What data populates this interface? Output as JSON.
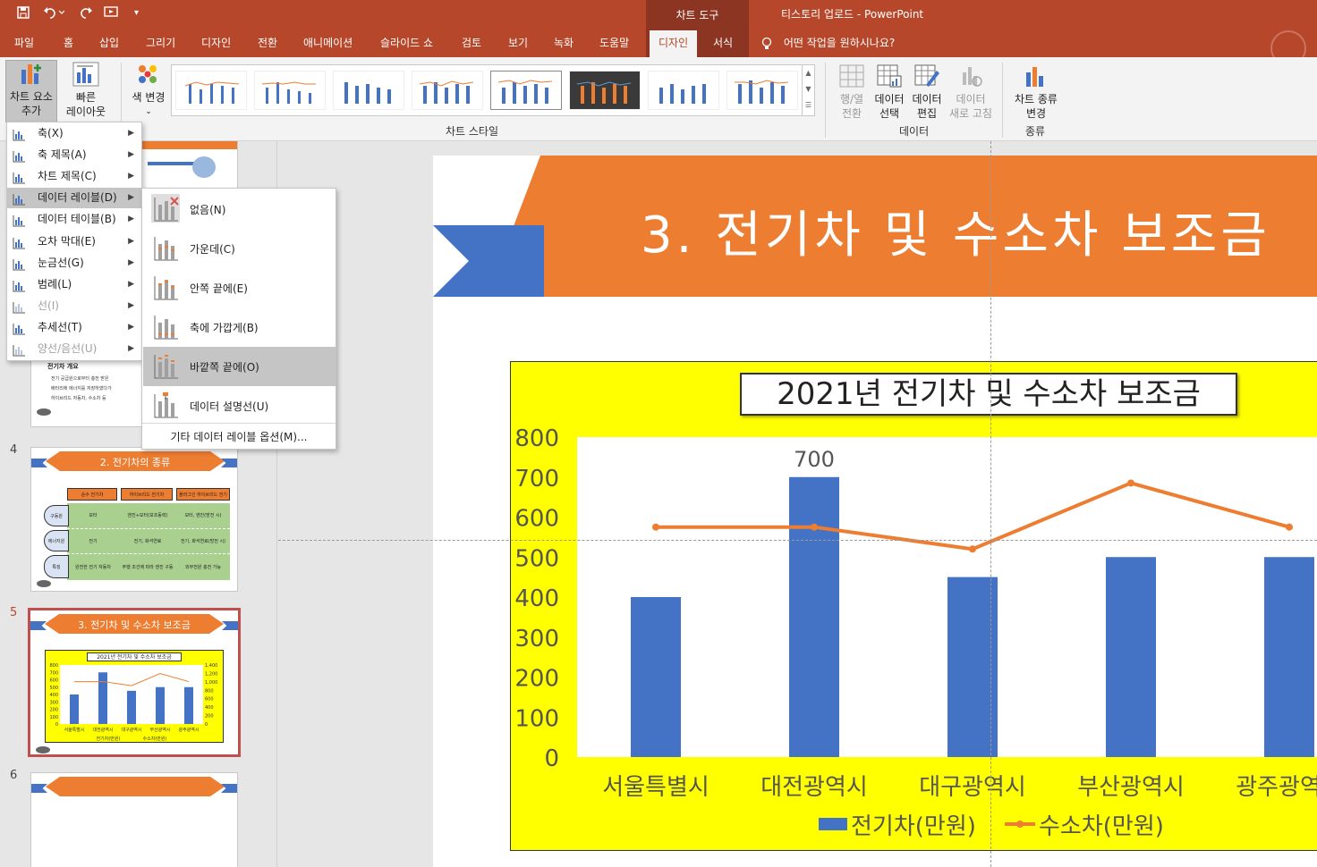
{
  "titlebar": {
    "context_tools": "차트 도구",
    "document_title": "티스토리 업로드  -  PowerPoint"
  },
  "tabs": [
    "파일",
    "홈",
    "삽입",
    "그리기",
    "디자인",
    "전환",
    "애니메이션",
    "슬라이드 쇼",
    "검토",
    "보기",
    "녹화",
    "도움말",
    "디자인",
    "서식"
  ],
  "tell_me": "어떤 작업을 원하시나요?",
  "ribbon": {
    "add_element": [
      "차트 요소",
      "추가"
    ],
    "quick_layout": [
      "빠른",
      "레이아웃"
    ],
    "change_color": "색 변경",
    "chart_styles_label": "차트 스타일",
    "switch_row_col": [
      "행/열",
      "전환"
    ],
    "select_data": [
      "데이터",
      "선택"
    ],
    "edit_data": [
      "데이터",
      "편집"
    ],
    "refresh_data": [
      "데이터",
      "새로 고침"
    ],
    "data_group": "데이터",
    "change_type": [
      "차트 종류",
      "변경"
    ],
    "type_group": "종류"
  },
  "menu_chart_element": [
    {
      "label": "축(X)",
      "enabled": true
    },
    {
      "label": "축 제목(A)",
      "enabled": true
    },
    {
      "label": "차트 제목(C)",
      "enabled": true
    },
    {
      "label": "데이터 레이블(D)",
      "enabled": true
    },
    {
      "label": "데이터 테이블(B)",
      "enabled": true
    },
    {
      "label": "오차 막대(E)",
      "enabled": true
    },
    {
      "label": "눈금선(G)",
      "enabled": true
    },
    {
      "label": "범례(L)",
      "enabled": true
    },
    {
      "label": "선(I)",
      "enabled": false
    },
    {
      "label": "추세선(T)",
      "enabled": true
    },
    {
      "label": "양선/음선(U)",
      "enabled": false
    }
  ],
  "menu_data_labels": [
    "없음(N)",
    "가운데(C)",
    "안쪽 끝에(E)",
    "축에 가깝게(B)",
    "바깥쪽 끝에(O)",
    "데이터 설명선(U)"
  ],
  "menu_more": "기타 데이터 레이블 옵션(M)...",
  "slides": {
    "numbers": [
      "4",
      "5",
      "6"
    ],
    "thumb3_title": "전기차 개요",
    "thumb3_lines": [
      "전기 공급원으로부터 충전 받은",
      "배터리에 에너지를 저장하였다가",
      "하이브리드 자동차, 수소차 등"
    ],
    "thumb4_title": "2. 전기차의 종류",
    "thumb4_table": {
      "headers": [
        "순수 전기차",
        "하이브리드 전기차",
        "플러그인 하이브리드 전기차"
      ],
      "rows": [
        {
          "label": "구동원",
          "cells": [
            "모터",
            "엔진+모터(보조동력)",
            "모터, 엔진(방전 시)"
          ]
        },
        {
          "label": "에너지원",
          "cells": [
            "전기",
            "전기, 화석연료",
            "전기, 화석연료(방전 시)"
          ]
        },
        {
          "label": "특징",
          "cells": [
            "완전한 전기 자동차",
            "주행 조건에 따라 엔진 구동",
            "외부전원 충전 가능"
          ]
        }
      ]
    },
    "thumb5_title": "3. 전기차 및 수소차 보조금",
    "thumb5_chart_title": "2021년 전기차 및 수소차 보조금"
  },
  "slide": {
    "title": "3. 전기차 및 수소차 보조금"
  },
  "chart_data": {
    "type": "bar",
    "title": "2021년 전기차 및 수소차 보조금",
    "categories": [
      "서울특별시",
      "대전광역시",
      "대구광역시",
      "부산광역시",
      "광주광역시"
    ],
    "series": [
      {
        "name": "전기차(만원)",
        "type": "bar",
        "values": [
          400,
          700,
          450,
          500,
          500
        ],
        "color": "#4472c4"
      },
      {
        "name": "수소차(만원)",
        "type": "line",
        "values": [
          575,
          575,
          520,
          685,
          575
        ],
        "color": "#ed7d31"
      }
    ],
    "data_labels": [
      {
        "series": 0,
        "index": 1,
        "text": "700"
      }
    ],
    "yticks": [
      "0",
      "100",
      "200",
      "300",
      "400",
      "500",
      "600",
      "700",
      "800"
    ],
    "ylim": [
      0,
      800
    ],
    "secondary_axis_labels": [
      "0",
      "200",
      "400",
      "600",
      "800",
      "1,000",
      "1,200",
      "1,400"
    ],
    "legend": "bottom",
    "background": "#ffff00",
    "plot_background": "#ffffff"
  },
  "colors": {
    "accent": "#b7472a",
    "context": "#8c3522",
    "orange": "#ed7d31",
    "blue": "#4472c4"
  }
}
